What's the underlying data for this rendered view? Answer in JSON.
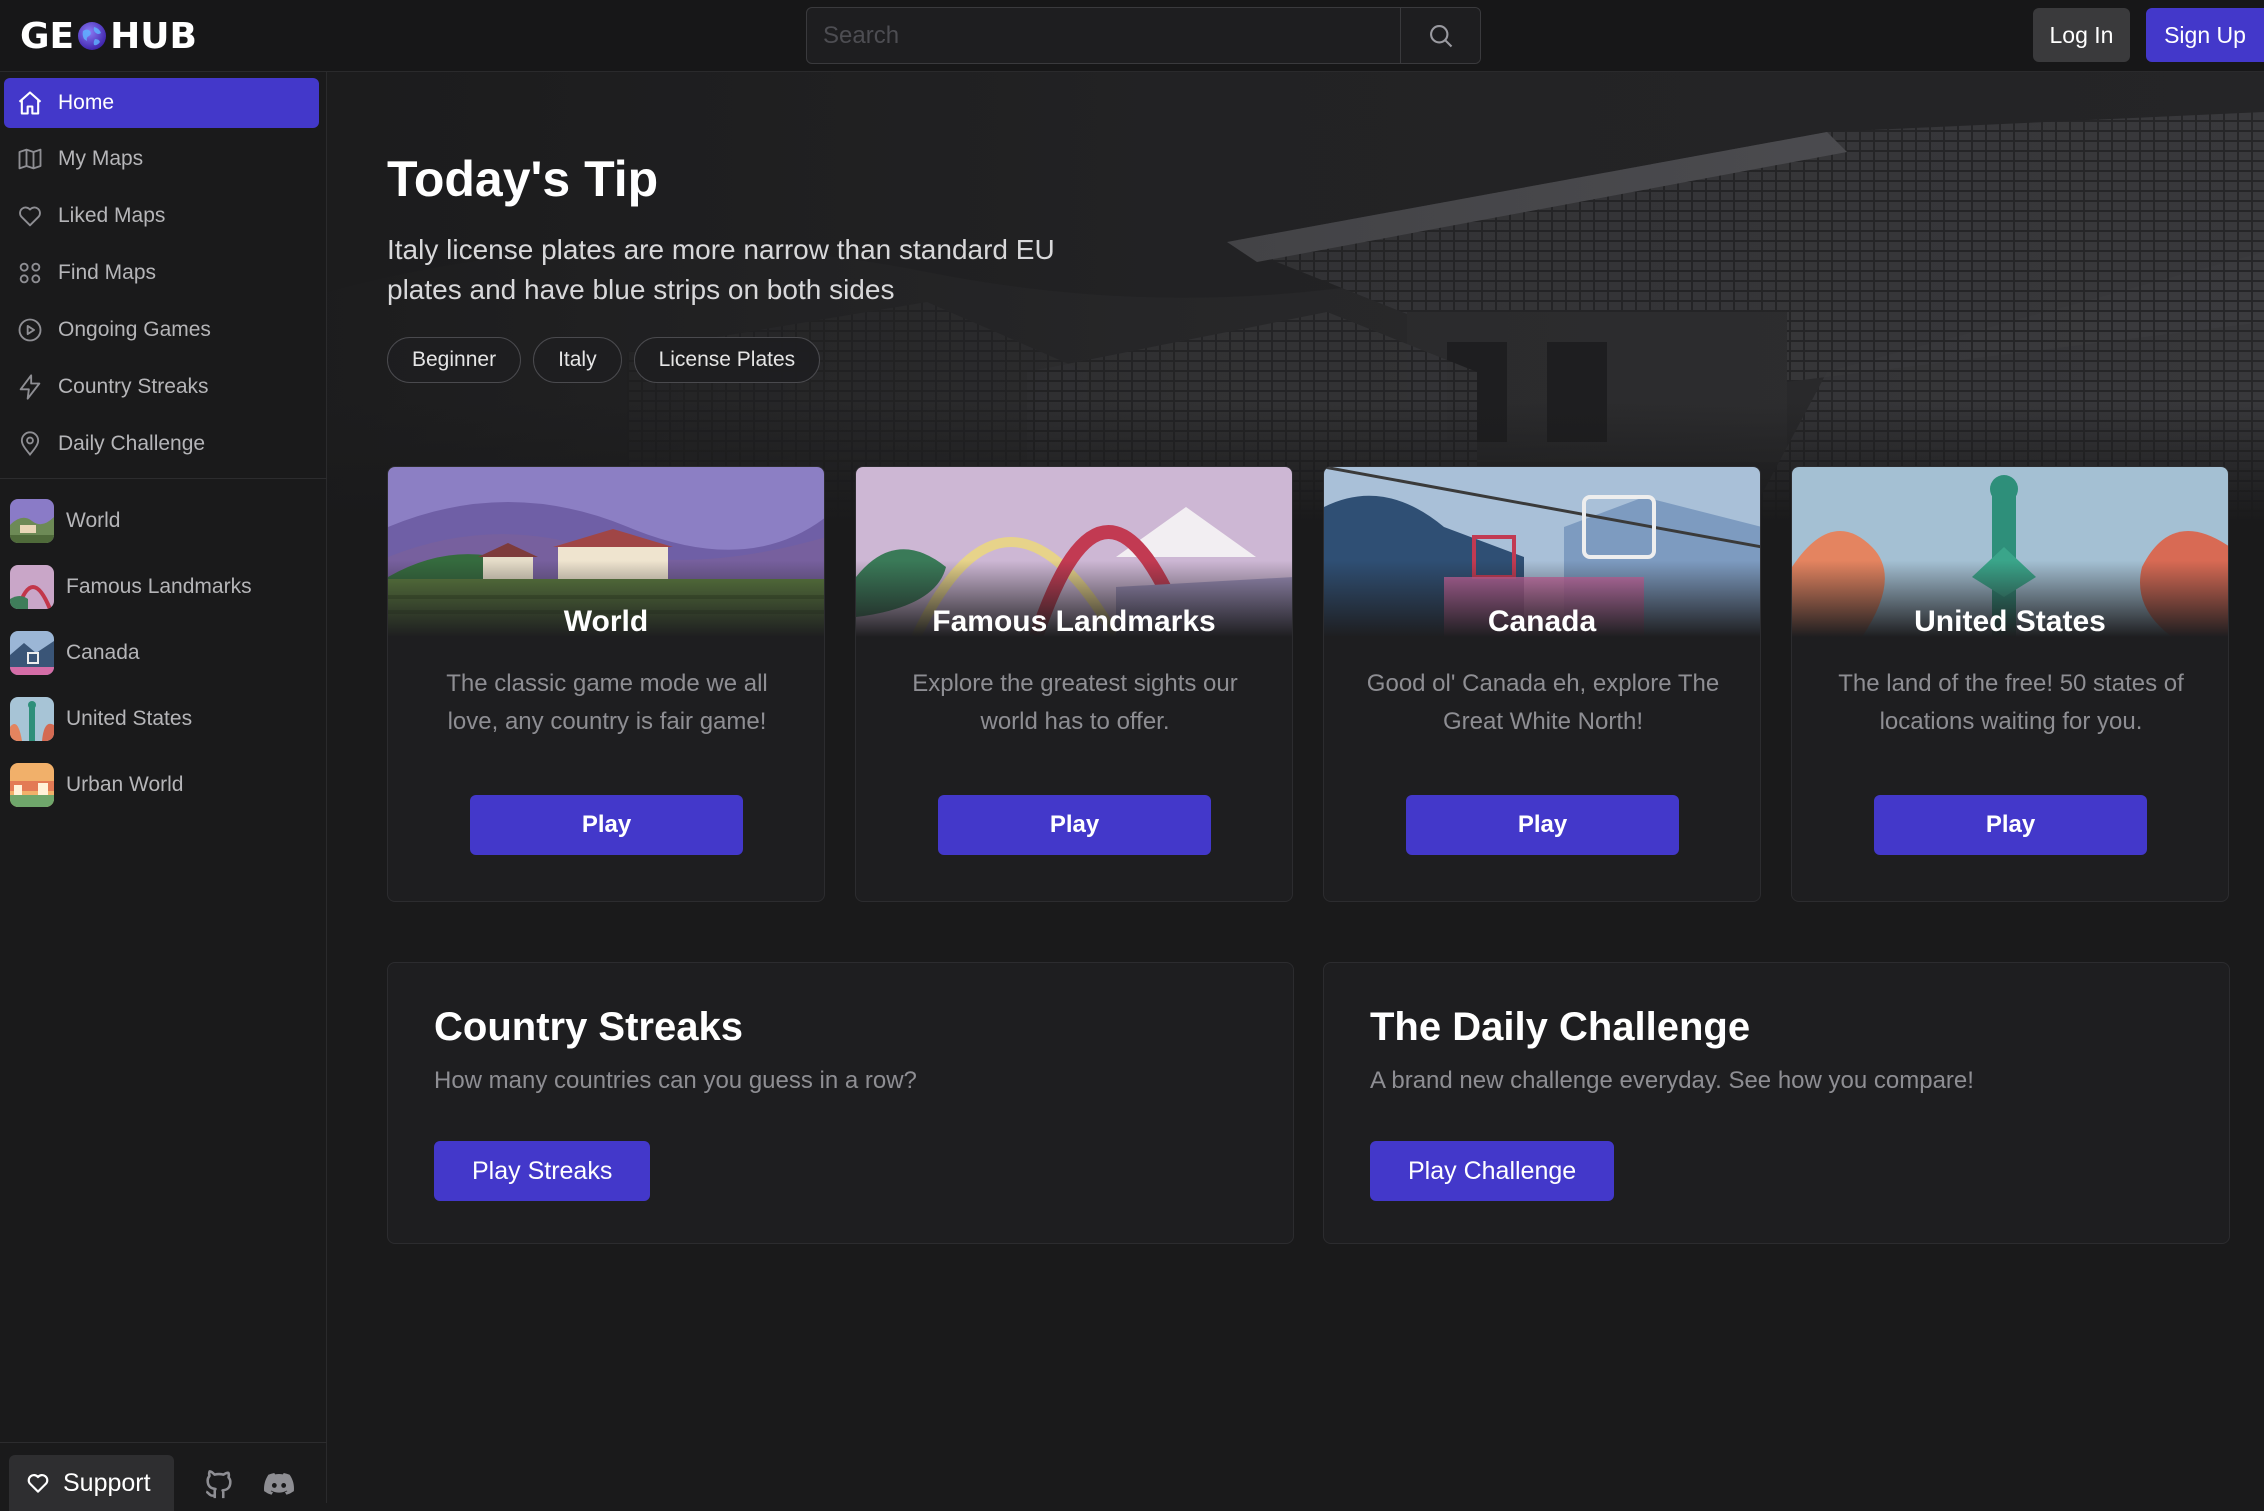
{
  "app": {
    "logo_left": "GE",
    "logo_right": "HUB"
  },
  "header": {
    "search_placeholder": "Search",
    "login_label": "Log In",
    "signup_label": "Sign Up"
  },
  "sidebar": {
    "nav": [
      {
        "label": "Home",
        "icon": "home-icon",
        "active": true
      },
      {
        "label": "My Maps",
        "icon": "map-icon"
      },
      {
        "label": "Liked Maps",
        "icon": "heart-icon"
      },
      {
        "label": "Find Maps",
        "icon": "grid-icon"
      },
      {
        "label": "Ongoing Games",
        "icon": "play-circle-icon"
      },
      {
        "label": "Country Streaks",
        "icon": "lightning-icon"
      },
      {
        "label": "Daily Challenge",
        "icon": "location-pin-icon"
      }
    ],
    "maps": [
      {
        "label": "World"
      },
      {
        "label": "Famous Landmarks"
      },
      {
        "label": "Canada"
      },
      {
        "label": "United States"
      },
      {
        "label": "Urban World"
      }
    ],
    "support_label": "Support"
  },
  "tip": {
    "title": "Today's Tip",
    "text": "Italy license plates are more narrow than standard EU plates and have blue strips on both sides",
    "tags": [
      "Beginner",
      "Italy",
      "License Plates"
    ]
  },
  "game_cards": [
    {
      "title": "World",
      "desc": "The classic game mode we all love, any country is fair game!",
      "button": "Play"
    },
    {
      "title": "Famous Landmarks",
      "desc": "Explore the greatest sights our world has to offer.",
      "button": "Play"
    },
    {
      "title": "Canada",
      "desc": "Good ol' Canada eh, explore The Great White North!",
      "button": "Play"
    },
    {
      "title": "United States",
      "desc": "The land of the free! 50 states of locations waiting for you.",
      "button": "Play"
    }
  ],
  "streaks": {
    "title": "Country Streaks",
    "subtitle": "How many countries can you guess in a row?",
    "button": "Play Streaks"
  },
  "daily": {
    "title": "The Daily Challenge",
    "subtitle": "A brand new challenge everyday. See how you compare!",
    "button": "Play Challenge"
  },
  "colors": {
    "accent": "#4338ca",
    "background": "#1a1a1b",
    "card": "#1e1e20"
  }
}
